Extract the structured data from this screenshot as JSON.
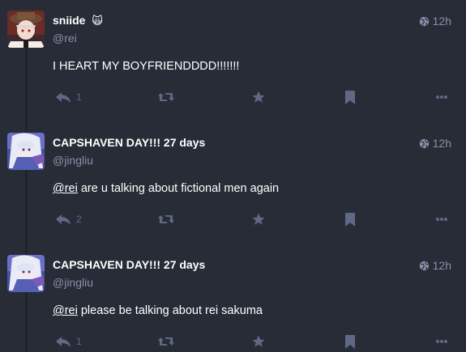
{
  "posts": [
    {
      "display_name": "sniide",
      "name_emoji": "🙀",
      "handle": "@rei",
      "time": "12h",
      "content": "I HEART MY BOYFRIENDDDD!!!!!!!",
      "mention": "",
      "reply_count": "1",
      "avatar": "avatar-boy-in-hat"
    },
    {
      "display_name": "CAPSHAVEN DAY!!! 27 days",
      "handle": "@jingliu",
      "time": "12h",
      "mention": "@rei",
      "content": " are u talking about fictional men again",
      "reply_count": "2",
      "avatar": "avatar-anime-girl-white-hair"
    },
    {
      "display_name": "CAPSHAVEN DAY!!! 27 days",
      "handle": "@jingliu",
      "time": "12h",
      "mention": "@rei",
      "content": " please be talking about rei sakuma",
      "reply_count": "1",
      "avatar": "avatar-anime-girl-white-hair"
    }
  ],
  "colors": {
    "background": "#282c37",
    "muted": "#606984",
    "handle": "#8a91a8"
  }
}
